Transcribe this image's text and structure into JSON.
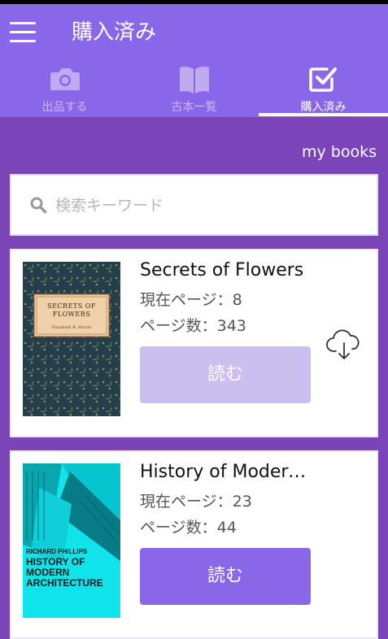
{
  "header": {
    "title": "購入済み"
  },
  "tabs": [
    {
      "label": "出品する",
      "icon": "camera-icon"
    },
    {
      "label": "古本一覧",
      "icon": "book-icon"
    },
    {
      "label": "購入済み",
      "icon": "checkbox-icon"
    }
  ],
  "my_books_link": "my books",
  "search": {
    "placeholder": "検索キーワード"
  },
  "books": [
    {
      "title": "Secrets of Flowers",
      "current_page_label": "現在ページ：",
      "current_page": "8",
      "pages_label": "ページ数：",
      "pages": "343",
      "read_label": "読む",
      "read_state": "disabled",
      "cover_title": "SECRETS OF FLOWERS",
      "cover_author": "Elizabeth R. Harris"
    },
    {
      "title": "History of Modern Architecture",
      "current_page_label": "現在ページ：",
      "current_page": "23",
      "pages_label": "ページ数：",
      "pages": "44",
      "read_label": "読む",
      "read_state": "enabled",
      "cover_author": "RICHARD PHILLIPS",
      "cover_title": "HISTORY OF MODERN ARCHITECTURE"
    }
  ],
  "colors": {
    "app_bar": "#8a67e8",
    "background": "#7b44b8",
    "button_enabled": "#8a67e8",
    "button_disabled": "#cbbff0"
  }
}
